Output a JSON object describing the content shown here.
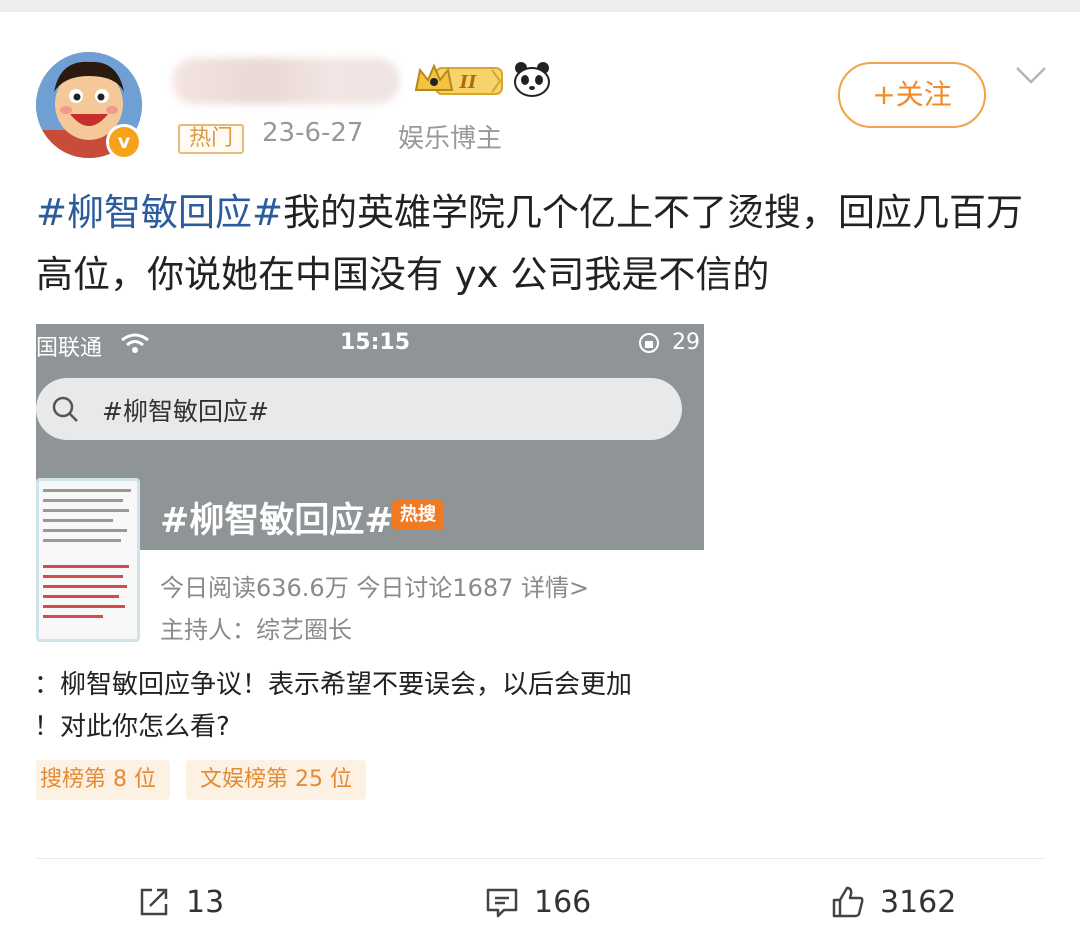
{
  "post": {
    "hot_tag": "热门",
    "date": "23-6-27",
    "role": "娱乐博主",
    "level_badge": "II",
    "follow_label": "+关注",
    "hashtag": "#柳智敏回应#",
    "text": "我的英雄学院几个亿上不了烫搜，回应几百万高位，你说她在中国没有 yx 公司我是不信的"
  },
  "embed": {
    "status_bar": {
      "carrier": "国联通",
      "time": "15:15",
      "battery": "29"
    },
    "search_text": "#柳智敏回应#",
    "topic": {
      "title": "#柳智敏回应#",
      "hot_badge": "热搜",
      "stats": "今日阅读636.6万  今日讨论1687  详情>",
      "host": "主持人：综艺圈长"
    },
    "news_line1": "：柳智敏回应争议！表示希望不要误会，以后会更加",
    "news_line2": "！对此你怎么看?",
    "rank1": "搜榜第 8 位",
    "rank2": "文娱榜第 25 位"
  },
  "actions": {
    "share_count": "13",
    "comment_count": "166",
    "like_count": "3162"
  },
  "colors": {
    "accent_orange": "#f08a2a",
    "hashtag_blue": "#2c5c9c",
    "verified_badge": "#f7a21b",
    "hot_badge": "#ef7a23"
  },
  "icons": [
    "verified-icon",
    "crown-level-icon",
    "panda-icon",
    "chevron-down-icon",
    "wifi-icon",
    "screen-lock-icon",
    "search-icon",
    "share-icon",
    "comment-icon",
    "like-icon"
  ]
}
